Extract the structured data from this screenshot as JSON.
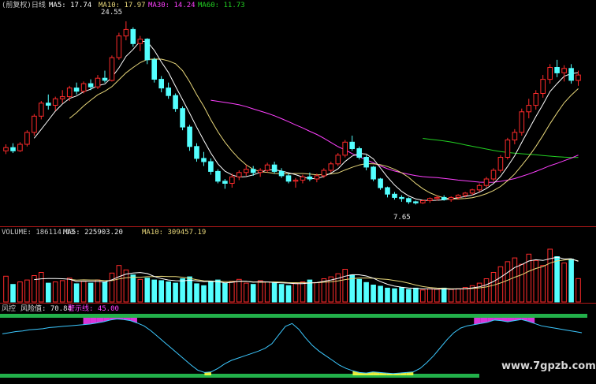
{
  "chart_data": [
    {
      "type": "candlestick",
      "name": "price-panel",
      "legend": {
        "prefix": "(前复权)日线",
        "ma5_label": "MA5: 17.74",
        "ma10_label": "MA10: 17.97",
        "ma30_label": "MA30: 14.24",
        "ma60_label": "MA60: 11.73"
      },
      "annotations": {
        "high_label": "24.55",
        "low_label": "7.65"
      },
      "ylim": [
        6.0,
        25.5
      ],
      "colors": {
        "up": "#ff2b2b",
        "down": "#54ffff",
        "ma5": "#ffffff",
        "ma10": "#e8d77a",
        "ma30": "#ff40ff",
        "ma60": "#22d022"
      },
      "candles": [
        {
          "o": 12.6,
          "h": 13.2,
          "l": 12.3,
          "c": 12.9
        },
        {
          "o": 12.9,
          "h": 13.3,
          "l": 12.4,
          "c": 12.6
        },
        {
          "o": 12.6,
          "h": 13.4,
          "l": 12.5,
          "c": 13.2
        },
        {
          "o": 13.2,
          "h": 14.5,
          "l": 13.0,
          "c": 14.3
        },
        {
          "o": 14.3,
          "h": 16.0,
          "l": 14.0,
          "c": 15.8
        },
        {
          "o": 15.8,
          "h": 17.2,
          "l": 15.5,
          "c": 17.0
        },
        {
          "o": 17.0,
          "h": 17.8,
          "l": 16.4,
          "c": 16.8
        },
        {
          "o": 16.8,
          "h": 17.6,
          "l": 16.3,
          "c": 17.4
        },
        {
          "o": 17.4,
          "h": 18.2,
          "l": 17.0,
          "c": 17.6
        },
        {
          "o": 17.6,
          "h": 18.6,
          "l": 17.2,
          "c": 18.4
        },
        {
          "o": 18.4,
          "h": 18.9,
          "l": 17.8,
          "c": 18.1
        },
        {
          "o": 18.1,
          "h": 19.0,
          "l": 17.9,
          "c": 18.8
        },
        {
          "o": 18.8,
          "h": 19.2,
          "l": 18.2,
          "c": 18.5
        },
        {
          "o": 18.5,
          "h": 19.6,
          "l": 18.3,
          "c": 19.3
        },
        {
          "o": 19.3,
          "h": 20.0,
          "l": 18.9,
          "c": 19.1
        },
        {
          "o": 19.1,
          "h": 21.4,
          "l": 19.0,
          "c": 21.2
        },
        {
          "o": 21.2,
          "h": 23.5,
          "l": 21.0,
          "c": 23.2
        },
        {
          "o": 23.2,
          "h": 24.55,
          "l": 22.8,
          "c": 23.8
        },
        {
          "o": 23.8,
          "h": 24.0,
          "l": 22.2,
          "c": 22.5
        },
        {
          "o": 22.5,
          "h": 23.2,
          "l": 21.8,
          "c": 22.9
        },
        {
          "o": 22.9,
          "h": 23.0,
          "l": 20.6,
          "c": 21.0
        },
        {
          "o": 21.0,
          "h": 21.2,
          "l": 18.9,
          "c": 19.2
        },
        {
          "o": 19.2,
          "h": 19.5,
          "l": 18.0,
          "c": 18.4
        },
        {
          "o": 18.4,
          "h": 18.9,
          "l": 17.4,
          "c": 17.7
        },
        {
          "o": 17.7,
          "h": 17.9,
          "l": 16.2,
          "c": 16.5
        },
        {
          "o": 16.5,
          "h": 16.7,
          "l": 14.5,
          "c": 14.8
        },
        {
          "o": 14.8,
          "h": 15.0,
          "l": 12.6,
          "c": 13.0
        },
        {
          "o": 13.0,
          "h": 13.3,
          "l": 11.6,
          "c": 11.9
        },
        {
          "o": 11.9,
          "h": 12.5,
          "l": 11.2,
          "c": 11.6
        },
        {
          "o": 11.6,
          "h": 11.9,
          "l": 10.4,
          "c": 10.7
        },
        {
          "o": 10.7,
          "h": 10.9,
          "l": 9.6,
          "c": 9.8
        },
        {
          "o": 9.8,
          "h": 10.0,
          "l": 9.1,
          "c": 9.6
        },
        {
          "o": 9.6,
          "h": 10.5,
          "l": 9.2,
          "c": 10.2
        },
        {
          "o": 10.2,
          "h": 10.8,
          "l": 9.9,
          "c": 10.6
        },
        {
          "o": 10.6,
          "h": 11.3,
          "l": 10.3,
          "c": 10.9
        },
        {
          "o": 10.9,
          "h": 11.2,
          "l": 10.3,
          "c": 10.6
        },
        {
          "o": 10.6,
          "h": 11.0,
          "l": 10.2,
          "c": 10.8
        },
        {
          "o": 10.8,
          "h": 11.5,
          "l": 10.6,
          "c": 11.3
        },
        {
          "o": 11.3,
          "h": 11.6,
          "l": 10.5,
          "c": 10.7
        },
        {
          "o": 10.7,
          "h": 11.0,
          "l": 10.1,
          "c": 10.3
        },
        {
          "o": 10.3,
          "h": 10.5,
          "l": 9.6,
          "c": 9.8
        },
        {
          "o": 9.8,
          "h": 10.1,
          "l": 9.2,
          "c": 9.9
        },
        {
          "o": 9.9,
          "h": 10.4,
          "l": 9.6,
          "c": 10.2
        },
        {
          "o": 10.2,
          "h": 10.6,
          "l": 9.8,
          "c": 10.0
        },
        {
          "o": 10.0,
          "h": 10.5,
          "l": 9.7,
          "c": 10.3
        },
        {
          "o": 10.3,
          "h": 11.0,
          "l": 10.1,
          "c": 10.8
        },
        {
          "o": 10.8,
          "h": 11.6,
          "l": 10.6,
          "c": 11.4
        },
        {
          "o": 11.4,
          "h": 12.4,
          "l": 11.2,
          "c": 12.2
        },
        {
          "o": 12.2,
          "h": 13.6,
          "l": 12.0,
          "c": 13.4
        },
        {
          "o": 13.4,
          "h": 14.0,
          "l": 12.6,
          "c": 12.8
        },
        {
          "o": 12.8,
          "h": 13.0,
          "l": 11.8,
          "c": 12.0
        },
        {
          "o": 12.0,
          "h": 12.2,
          "l": 10.8,
          "c": 11.1
        },
        {
          "o": 11.1,
          "h": 11.2,
          "l": 9.8,
          "c": 10.0
        },
        {
          "o": 10.0,
          "h": 10.1,
          "l": 9.0,
          "c": 9.2
        },
        {
          "o": 9.2,
          "h": 9.3,
          "l": 8.3,
          "c": 8.6
        },
        {
          "o": 8.6,
          "h": 8.8,
          "l": 8.1,
          "c": 8.3
        },
        {
          "o": 8.3,
          "h": 8.5,
          "l": 7.9,
          "c": 8.2
        },
        {
          "o": 8.2,
          "h": 8.3,
          "l": 7.7,
          "c": 7.9
        },
        {
          "o": 7.9,
          "h": 8.0,
          "l": 7.65,
          "c": 7.8
        },
        {
          "o": 7.8,
          "h": 8.1,
          "l": 7.7,
          "c": 8.0
        },
        {
          "o": 8.0,
          "h": 8.3,
          "l": 7.8,
          "c": 8.2
        },
        {
          "o": 8.2,
          "h": 8.5,
          "l": 8.0,
          "c": 8.3
        },
        {
          "o": 8.3,
          "h": 8.5,
          "l": 8.0,
          "c": 8.1
        },
        {
          "o": 8.1,
          "h": 8.4,
          "l": 7.9,
          "c": 8.3
        },
        {
          "o": 8.3,
          "h": 8.6,
          "l": 8.1,
          "c": 8.5
        },
        {
          "o": 8.5,
          "h": 8.8,
          "l": 8.3,
          "c": 8.7
        },
        {
          "o": 8.7,
          "h": 9.1,
          "l": 8.5,
          "c": 9.0
        },
        {
          "o": 9.0,
          "h": 9.6,
          "l": 8.8,
          "c": 9.4
        },
        {
          "o": 9.4,
          "h": 10.2,
          "l": 9.2,
          "c": 10.0
        },
        {
          "o": 10.0,
          "h": 11.0,
          "l": 9.8,
          "c": 10.8
        },
        {
          "o": 10.8,
          "h": 12.2,
          "l": 10.6,
          "c": 12.0
        },
        {
          "o": 12.0,
          "h": 13.8,
          "l": 11.8,
          "c": 13.6
        },
        {
          "o": 13.6,
          "h": 14.6,
          "l": 13.2,
          "c": 14.3
        },
        {
          "o": 14.3,
          "h": 16.5,
          "l": 14.0,
          "c": 16.2
        },
        {
          "o": 16.2,
          "h": 17.4,
          "l": 15.6,
          "c": 16.8
        },
        {
          "o": 16.8,
          "h": 18.2,
          "l": 16.4,
          "c": 17.9
        },
        {
          "o": 17.9,
          "h": 19.6,
          "l": 17.5,
          "c": 19.2
        },
        {
          "o": 19.2,
          "h": 20.6,
          "l": 18.8,
          "c": 20.3
        },
        {
          "o": 20.3,
          "h": 21.0,
          "l": 19.4,
          "c": 19.8
        },
        {
          "o": 19.8,
          "h": 20.5,
          "l": 19.0,
          "c": 20.2
        },
        {
          "o": 20.2,
          "h": 20.6,
          "l": 18.8,
          "c": 19.1
        },
        {
          "o": 19.1,
          "h": 20.0,
          "l": 18.6,
          "c": 19.6
        }
      ]
    },
    {
      "type": "bar",
      "name": "volume-panel",
      "legend": {
        "volume_label": "VOLUME: 186114.13",
        "ma5_label": "MA5: 225903.20",
        "ma10_label": "MA10: 309457.19"
      },
      "ylim": [
        0,
        520000
      ],
      "values": [
        205000,
        140000,
        160000,
        175000,
        210000,
        235000,
        150000,
        160000,
        170000,
        190000,
        145000,
        165000,
        150000,
        175000,
        160000,
        230000,
        290000,
        255000,
        215000,
        180000,
        190000,
        175000,
        170000,
        160000,
        150000,
        185000,
        200000,
        145000,
        130000,
        160000,
        175000,
        150000,
        165000,
        180000,
        150000,
        140000,
        170000,
        160000,
        150000,
        140000,
        130000,
        150000,
        160000,
        175000,
        155000,
        185000,
        200000,
        225000,
        260000,
        215000,
        180000,
        155000,
        135000,
        125000,
        110000,
        105000,
        115000,
        100000,
        110000,
        95000,
        105000,
        100000,
        110000,
        100000,
        105000,
        115000,
        130000,
        150000,
        185000,
        235000,
        280000,
        320000,
        350000,
        300000,
        380000,
        330000,
        290000,
        420000,
        360000,
        310000,
        340000,
        186114
      ]
    },
    {
      "type": "line",
      "name": "risk-panel",
      "legend": {
        "name_label": "风控",
        "risk_label": "风险值: 70.84",
        "warn_label": "警示线: 45.00"
      },
      "ylim": [
        0,
        100
      ],
      "values": [
        72,
        74,
        76,
        77,
        79,
        80,
        81,
        83,
        84,
        85,
        86,
        87,
        88,
        89,
        91,
        93,
        96,
        98,
        97,
        95,
        91,
        86,
        78,
        68,
        58,
        48,
        38,
        28,
        18,
        9,
        5,
        6,
        12,
        20,
        26,
        30,
        34,
        38,
        42,
        47,
        55,
        70,
        85,
        90,
        80,
        65,
        52,
        42,
        34,
        26,
        18,
        12,
        8,
        5,
        4,
        6,
        5,
        4,
        3,
        4,
        5,
        6,
        12,
        22,
        34,
        48,
        62,
        74,
        82,
        86,
        88,
        90,
        92,
        96,
        95,
        93,
        95,
        97,
        94,
        90,
        86,
        84,
        82,
        80,
        78,
        76,
        74
      ]
    }
  ],
  "watermark": "www.7gpzb.com"
}
